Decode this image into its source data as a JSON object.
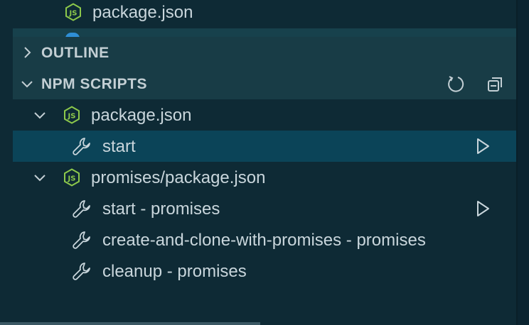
{
  "top_file": {
    "label": "package.json",
    "icon": "nodejs-hexagon-icon"
  },
  "outline": {
    "title": "OUTLINE",
    "chevron": "chevron-right-icon"
  },
  "npm_scripts": {
    "title": "NPM SCRIPTS",
    "refresh_icon": "refresh-icon",
    "collapse_icon": "collapse-all-icon",
    "groups": [
      {
        "label": "package.json",
        "scripts": [
          {
            "label": "start",
            "selected": true,
            "runnable": true
          }
        ]
      },
      {
        "label": "promises/package.json",
        "scripts": [
          {
            "label": "start - promises",
            "selected": false,
            "runnable": true
          },
          {
            "label": "create-and-clone-with-promises - promises",
            "selected": false,
            "runnable": false
          },
          {
            "label": "cleanup - promises",
            "selected": false,
            "runnable": false
          }
        ]
      }
    ]
  },
  "colors": {
    "background": "#0e2a35",
    "section_header": "#183c46",
    "selected_row": "#0b4458",
    "nodejs_green": "#8cc84b",
    "text": "#c9d6dc"
  }
}
